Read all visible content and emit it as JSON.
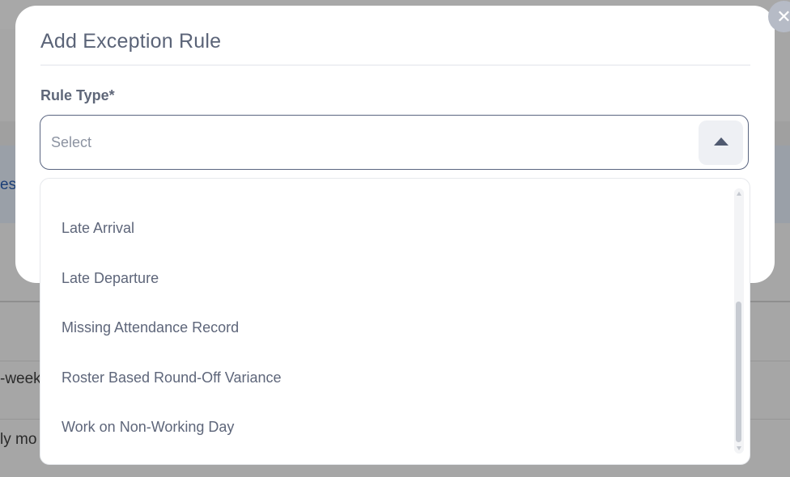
{
  "background": {
    "text_1": "es",
    "text_2": "-week",
    "text_3": "ly mo"
  },
  "modal": {
    "title": "Add Exception Rule",
    "close_symbol": "✕",
    "field": {
      "label": "Rule Type*",
      "placeholder": "Select",
      "toggle_icon": "caret-up-icon"
    }
  },
  "dropdown": {
    "options": [
      "Late Arrival",
      "Late Departure",
      "Missing Attendance Record",
      "Roster Based Round-Off Variance",
      "Work on Non-Working Day"
    ],
    "scroll_fraction": 0.55
  },
  "colors": {
    "accent_text": "#5b6478",
    "select_border": "#5a6580",
    "overlay": "#a6a6a6"
  }
}
